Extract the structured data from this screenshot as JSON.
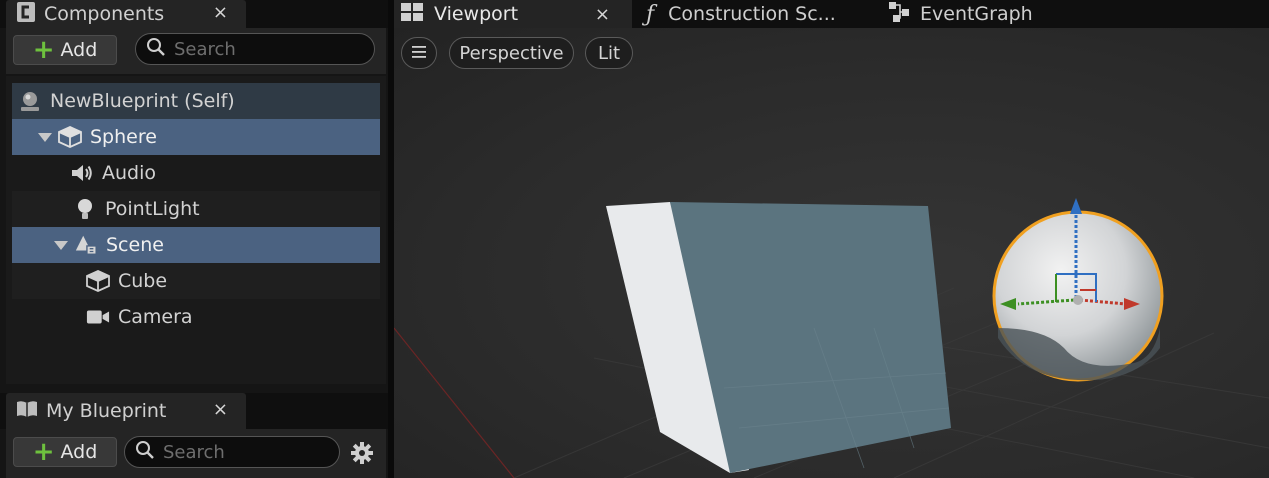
{
  "components_panel": {
    "tab_title": "Components",
    "close_glyph": "×",
    "add_label": "Add",
    "add_glyph": "+",
    "search_placeholder": "Search",
    "tree": [
      {
        "label": "NewBlueprint (Self)",
        "icon": "blueprint-self-icon"
      },
      {
        "label": "Sphere",
        "icon": "static-mesh-icon"
      },
      {
        "label": "Audio",
        "icon": "audio-icon"
      },
      {
        "label": "PointLight",
        "icon": "point-light-icon"
      },
      {
        "label": "Scene",
        "icon": "scene-component-icon"
      },
      {
        "label": "Cube",
        "icon": "static-mesh-icon"
      },
      {
        "label": "Camera",
        "icon": "camera-icon"
      }
    ]
  },
  "my_blueprint_panel": {
    "tab_title": "My Blueprint",
    "close_glyph": "×",
    "add_label": "Add",
    "add_glyph": "+",
    "search_placeholder": "Search",
    "settings_icon": "gear-icon"
  },
  "editor_tabs": [
    {
      "label": "Viewport",
      "icon": "viewport-icon",
      "close_glyph": "×"
    },
    {
      "label": "Construction Sc...",
      "icon": "function-icon"
    },
    {
      "label": "EventGraph",
      "icon": "event-graph-icon"
    }
  ],
  "viewport_toolbar": {
    "menu_icon": "hamburger-menu-icon",
    "perspective_label": "Perspective",
    "lit_label": "Lit"
  },
  "colors": {
    "selection": "#4b6281",
    "add_green": "#6ec13e",
    "gizmo_x": "#c0392b",
    "gizmo_y": "#3c8f22",
    "gizmo_z": "#2f6fc2",
    "sphere_outline": "#f0a020"
  }
}
